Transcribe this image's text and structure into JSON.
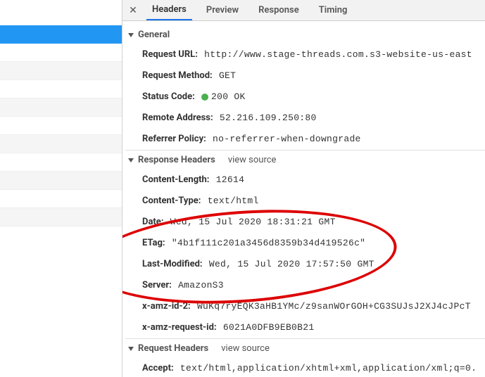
{
  "tabs": {
    "headers": "Headers",
    "preview": "Preview",
    "response": "Response",
    "timing": "Timing"
  },
  "sections": {
    "general": "General",
    "response_headers": "Response Headers",
    "request_headers": "Request Headers",
    "view_source": "view source"
  },
  "general": {
    "request_url_k": "Request URL:",
    "request_url_v": "http://www.stage-threads.com.s3-website-us-east",
    "request_method_k": "Request Method:",
    "request_method_v": "GET",
    "status_code_k": "Status Code:",
    "status_code_v": "200 OK",
    "remote_addr_k": "Remote Address:",
    "remote_addr_v": "52.216.109.250:80",
    "referrer_policy_k": "Referrer Policy:",
    "referrer_policy_v": "no-referrer-when-downgrade"
  },
  "resp": {
    "content_length_k": "Content-Length:",
    "content_length_v": "12614",
    "content_type_k": "Content-Type:",
    "content_type_v": "text/html",
    "date_k": "Date:",
    "date_v": "Wed, 15 Jul 2020 18:31:21 GMT",
    "etag_k": "ETag:",
    "etag_v": "\"4b1f111c201a3456d8359b34d419526c\"",
    "last_modified_k": "Last-Modified:",
    "last_modified_v": "Wed, 15 Jul 2020 17:57:50 GMT",
    "server_k": "Server:",
    "server_v": "AmazonS3",
    "x_amz_id2_k": "x-amz-id-2:",
    "x_amz_id2_v": "WuKq7ryEQK3aHB1YMc/z9sanWOrGOH+CG3SUJsJ2XJ4cJPcT",
    "x_amz_reqid_k": "x-amz-request-id:",
    "x_amz_reqid_v": "6021A0DFB9EB0B21"
  },
  "req": {
    "accept_k": "Accept:",
    "accept_v": "text/html,application/xhtml+xml,application/xml;q=0."
  }
}
